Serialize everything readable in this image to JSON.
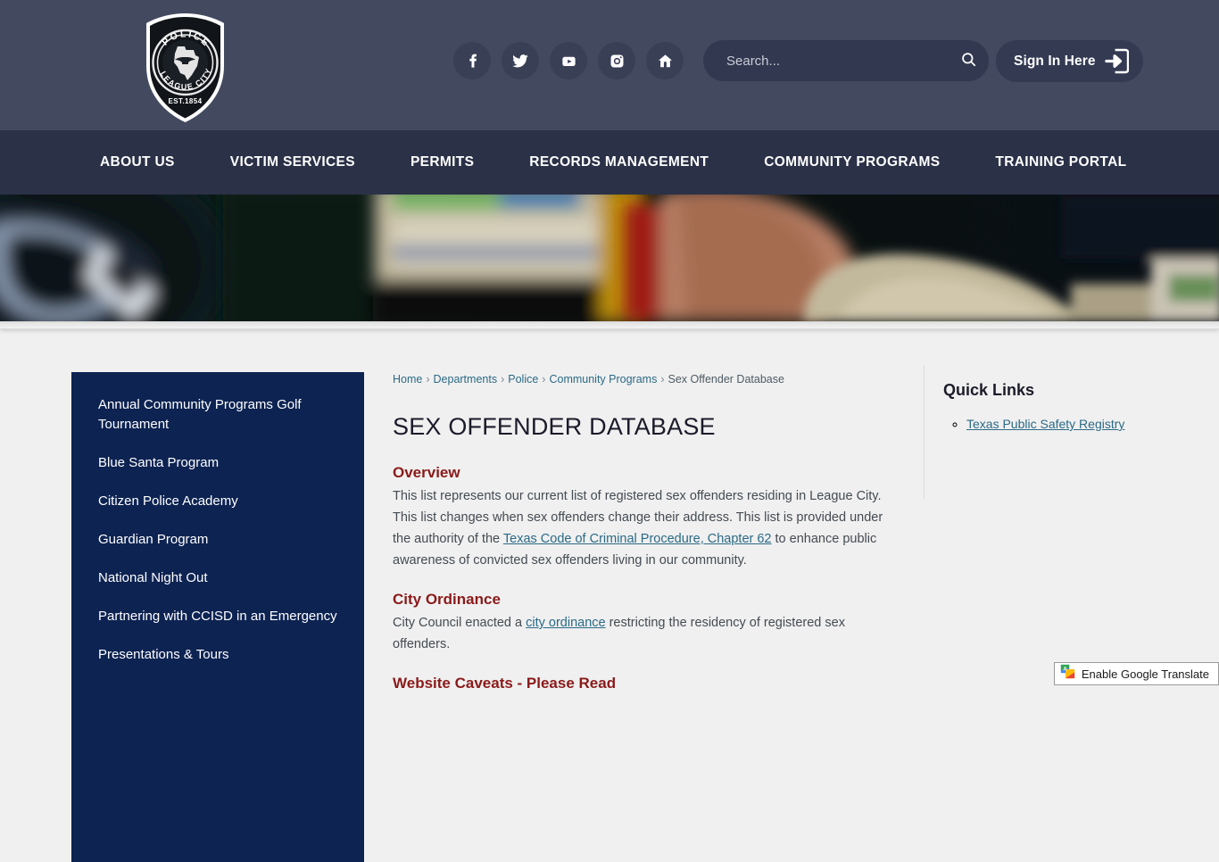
{
  "header": {
    "logo": {
      "top_text": "POLICE",
      "bottom_text": "LEAGUE CITY",
      "est_text": "EST.1854"
    },
    "social": [
      {
        "name": "facebook-icon",
        "label": "Facebook"
      },
      {
        "name": "twitter-icon",
        "label": "Twitter"
      },
      {
        "name": "youtube-icon",
        "label": "YouTube"
      },
      {
        "name": "instagram-icon",
        "label": "Instagram"
      },
      {
        "name": "nextdoor-icon",
        "label": "Nextdoor"
      }
    ],
    "search": {
      "placeholder": "Search...",
      "value": "",
      "icon": "search-icon"
    },
    "signin": {
      "label": "Sign In Here",
      "icon": "sign-in-arrow-icon"
    }
  },
  "nav": {
    "items": [
      {
        "label": "ABOUT US"
      },
      {
        "label": "VICTIM SERVICES"
      },
      {
        "label": "PERMITS"
      },
      {
        "label": "RECORDS MANAGEMENT"
      },
      {
        "label": "COMMUNITY PROGRAMS"
      },
      {
        "label": "TRAINING PORTAL"
      }
    ]
  },
  "hero": {
    "alt": "Blurred photo of a police shoulder patch with an officer in tan uniform"
  },
  "sidebar": {
    "items": [
      {
        "label": "Annual Community Programs Golf Tournament"
      },
      {
        "label": "Blue Santa Program"
      },
      {
        "label": "Citizen Police Academy"
      },
      {
        "label": "Guardian Program"
      },
      {
        "label": "National Night Out"
      },
      {
        "label": "Partnering with CCISD in an Emergency"
      },
      {
        "label": "Presentations & Tours"
      }
    ]
  },
  "breadcrumb": {
    "items": [
      {
        "label": "Home",
        "link": true
      },
      {
        "label": "Departments",
        "link": true
      },
      {
        "label": "Police",
        "link": true
      },
      {
        "label": "Community Programs",
        "link": true
      },
      {
        "label": "Sex Offender Database",
        "link": false
      }
    ],
    "separator": "›"
  },
  "main": {
    "title": "SEX OFFENDER DATABASE",
    "sections": [
      {
        "heading": "Overview",
        "text_before": "This list represents our current list of registered sex offenders residing in League City. This list changes when sex offenders change their address. This list is provided under the authority of the ",
        "link": "Texas Code of Criminal Procedure, Chapter 62",
        "text_after": " to enhance public awareness of convicted sex offenders living in our community."
      },
      {
        "heading": "City Ordinance",
        "text_before": "City Council enacted a ",
        "link": "city ordinance",
        "text_after": " restricting the residency of registered sex offenders."
      },
      {
        "heading": "Website Caveats - Please Read",
        "text_before": "",
        "link": "",
        "text_after": ""
      }
    ]
  },
  "quick_links": {
    "title": "Quick Links",
    "items": [
      {
        "label": "Texas Public Safety Registry"
      }
    ]
  },
  "google_translate": {
    "label": "Enable Google Translate",
    "icon": "google-translate-icon"
  },
  "colors": {
    "header_bg": "#434a60",
    "nav_bg": "#2b3147",
    "sidebar_bg": "#0d2352",
    "page_bg": "#f0f0f0",
    "heading_red": "#8b1a1a",
    "link_blue": "#2b6a86"
  }
}
